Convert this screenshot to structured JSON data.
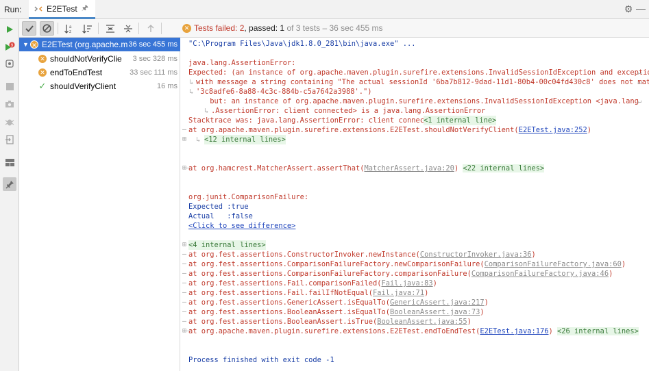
{
  "topbar": {
    "run_label": "Run:",
    "tab_name": "E2ETest"
  },
  "status": {
    "failed_label": "Tests failed: ",
    "failed_count": "2",
    "passed_label": ", passed: ",
    "passed_count": "1",
    "of_total": " of 3 tests – 36 sec 455 ms"
  },
  "tree": {
    "root": {
      "name": "E2ETest (org.apache.m",
      "time": "36 sec 455 ms"
    },
    "items": [
      {
        "name": "shouldNotVerifyClie",
        "time": "3 sec 328 ms",
        "status": "failed"
      },
      {
        "name": "endToEndTest",
        "time": "33 sec 111 ms",
        "status": "failed"
      },
      {
        "name": "shouldVerifyClient",
        "time": "16 ms",
        "status": "passed"
      }
    ]
  },
  "console": {
    "cmd": "\"C:\\Program Files\\Java\\jdk1.8.0_281\\bin\\java.exe\" ...",
    "l1": "java.lang.AssertionError:",
    "l2": "Expected: (an instance of org.apache.maven.plugin.surefire.extensions.InvalidSessionIdException and exception",
    "l3": "with message a string containing \"The actual sessionId '6ba7b812-9dad-11d1-80b4-00c04fd430c8' does not match",
    "l4": "'3c8adfe6-8a88-4c3c-884b-c5a7642a3988'.\")",
    "l5": "     but: an instance of org.apache.maven.plugin.surefire.extensions.InvalidSessionIdException <java.lang",
    "l6": ".AssertionError: client connected> is a java.lang.AssertionError",
    "l7a": "Stacktrace was: java.lang.AssertionError: client connected ",
    "l7b": "<1 internal line>",
    "l8a": "at org.apache.maven.plugin.surefire.extensions.E2ETest.shouldNotVerifyClient(",
    "l8link": "E2ETest.java:252",
    "l8b": ")",
    "l9": "<12 internal lines>",
    "l10a": "at org.hamcrest.MatcherAssert.assertThat(",
    "l10link": "MatcherAssert.java:20",
    "l10b": ") ",
    "l10c": "<22 internal lines>",
    "l11": "org.junit.ComparisonFailure:",
    "l12": "Expected :true",
    "l13": "Actual   :false",
    "l14": "<Click to see difference>",
    "l15": "<4 internal lines>",
    "stack": [
      {
        "pre": "at org.fest.assertions.ConstructorInvoker.newInstance(",
        "link": "ConstructorInvoker.java:36",
        "post": ")"
      },
      {
        "pre": "at org.fest.assertions.ComparisonFailureFactory.newComparisonFailure(",
        "link": "ComparisonFailureFactory.java:60",
        "post": ")"
      },
      {
        "pre": "at org.fest.assertions.ComparisonFailureFactory.comparisonFailure(",
        "link": "ComparisonFailureFactory.java:46",
        "post": ")"
      },
      {
        "pre": "at org.fest.assertions.Fail.comparisonFailed(",
        "link": "Fail.java:83",
        "post": ")"
      },
      {
        "pre": "at org.fest.assertions.Fail.failIfNotEqual(",
        "link": "Fail.java:71",
        "post": ")"
      },
      {
        "pre": "at org.fest.assertions.GenericAssert.isEqualTo(",
        "link": "GenericAssert.java:217",
        "post": ")"
      },
      {
        "pre": "at org.fest.assertions.BooleanAssert.isEqualTo(",
        "link": "BooleanAssert.java:73",
        "post": ")"
      },
      {
        "pre": "at org.fest.assertions.BooleanAssert.isTrue(",
        "link": "BooleanAssert.java:55",
        "post": ")"
      }
    ],
    "l24a": "at org.apache.maven.plugin.surefire.extensions.E2ETest.endToEndTest(",
    "l24link": "E2ETest.java:176",
    "l24b": ") ",
    "l24c": "<26 internal lines>",
    "finish": "Process finished with exit code -1"
  }
}
